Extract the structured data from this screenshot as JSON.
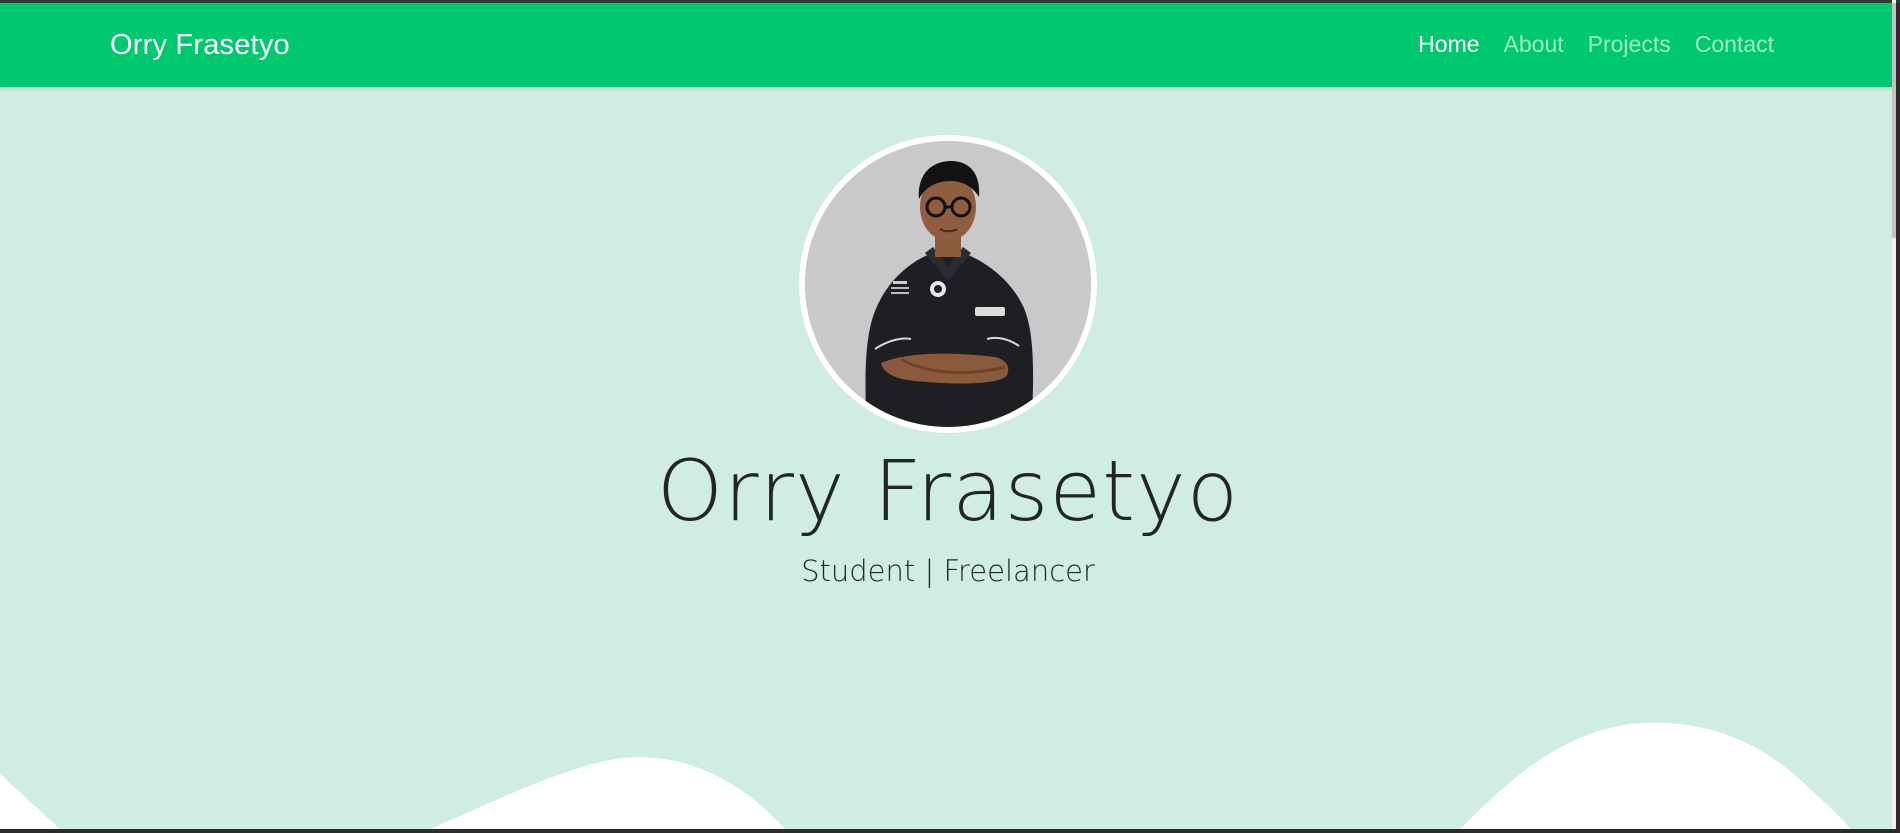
{
  "navbar": {
    "brand": "Orry Frasetyo",
    "links": [
      {
        "label": "Home",
        "active": true
      },
      {
        "label": "About",
        "active": false
      },
      {
        "label": "Projects",
        "active": false
      },
      {
        "label": "Contact",
        "active": false
      }
    ]
  },
  "hero": {
    "name": "Orry Frasetyo",
    "subtitle": "Student | Freelancer"
  },
  "colors": {
    "navbar_bg": "#00c86e",
    "hero_bg": "#cfede0",
    "wave": "#ffffff",
    "text_dark": "#212529"
  }
}
